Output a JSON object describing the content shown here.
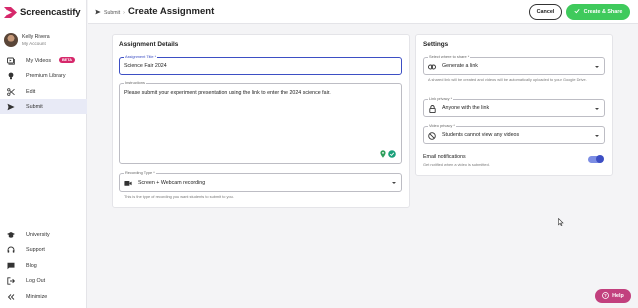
{
  "brand": {
    "name": "Screencastify",
    "color": "#d6286b"
  },
  "user": {
    "name": "Kelly Rivera",
    "subtitle": "My Account"
  },
  "nav": {
    "top": [
      {
        "label": "My Videos",
        "icon": "video-library-icon",
        "badge": "BETA"
      },
      {
        "label": "Premium Library",
        "icon": "lightbulb-icon"
      },
      {
        "label": "Edit",
        "icon": "scissors-icon"
      },
      {
        "label": "Submit",
        "icon": "send-icon",
        "active": true
      }
    ],
    "bottom": [
      {
        "label": "University",
        "icon": "graduation-cap-icon"
      },
      {
        "label": "Support",
        "icon": "headset-icon"
      },
      {
        "label": "Blog",
        "icon": "chat-icon"
      },
      {
        "label": "Log Out",
        "icon": "logout-icon"
      },
      {
        "label": "Minimize",
        "icon": "collapse-icon"
      }
    ]
  },
  "header": {
    "breadcrumb": "Submit",
    "title": "Create Assignment",
    "cancel_label": "Cancel",
    "create_label": "Create & Share"
  },
  "details": {
    "title": "Assignment Details",
    "assignment_title": {
      "label": "Assignment Title *",
      "value": "Science Fair 2024"
    },
    "instructions": {
      "label": "Instructions",
      "value": "Please submit your experiment presentation using the link to enter the 2024 science fair."
    },
    "recording_type": {
      "label": "Recording Type *",
      "value": "Screen + Webcam recording",
      "helper": "This is the type of recording you want students to submit to you."
    }
  },
  "settings": {
    "title": "Settings",
    "share": {
      "label": "Select where to share *",
      "value": "Generate a link",
      "helper": "A shared link will be created and videos will be automatically uploaded to your Google Drive."
    },
    "link_privacy": {
      "label": "Link privacy *",
      "value": "Anyone with the link"
    },
    "video_privacy": {
      "label": "Video privacy *",
      "value": "Students cannot view any videos"
    },
    "email": {
      "label": "Email notifications",
      "helper": "Get notified when a video is submitted.",
      "enabled": true
    }
  },
  "help": {
    "label": "Help"
  },
  "colors": {
    "accent": "#3d4fc4",
    "success": "#3fca5c",
    "help": "#c2407e"
  }
}
